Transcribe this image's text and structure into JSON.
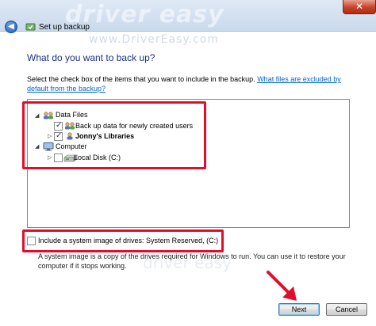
{
  "window": {
    "title": "Set up backup",
    "back_glyph": "◀",
    "close_glyph": "✕",
    "watermark": "driver easy",
    "watermark_url": "www.DriverEasy.com"
  },
  "main": {
    "heading": "What do you want to back up?",
    "instructions": "Select the check box of the items that you want to include in the backup.",
    "help_link": "What files are excluded by default from the backup?"
  },
  "tree": {
    "data_files": {
      "label": "Data Files",
      "expander": "◢",
      "icon": "users-icon",
      "children": [
        {
          "label": "Back up data for newly created users",
          "checked": true
        },
        {
          "label": "Jonny's Libraries",
          "checked": true,
          "bold": true,
          "expander": "▷"
        }
      ]
    },
    "computer": {
      "label": "Computer",
      "expander": "◢",
      "icon": "computer-icon",
      "children": [
        {
          "label": "Local Disk (C:)",
          "checked": false,
          "expander": "▷"
        }
      ]
    }
  },
  "system_image": {
    "label": "Include a system image of drives: System Reserved, (C:)",
    "checked": false,
    "description": "A system image is a copy of the drives required for Windows to run. You can use it to restore your computer if it stops working."
  },
  "buttons": {
    "next": "Next",
    "cancel": "Cancel"
  },
  "colors": {
    "highlight": "#e10d2b",
    "heading": "#1e3287",
    "link": "#0066cc"
  }
}
